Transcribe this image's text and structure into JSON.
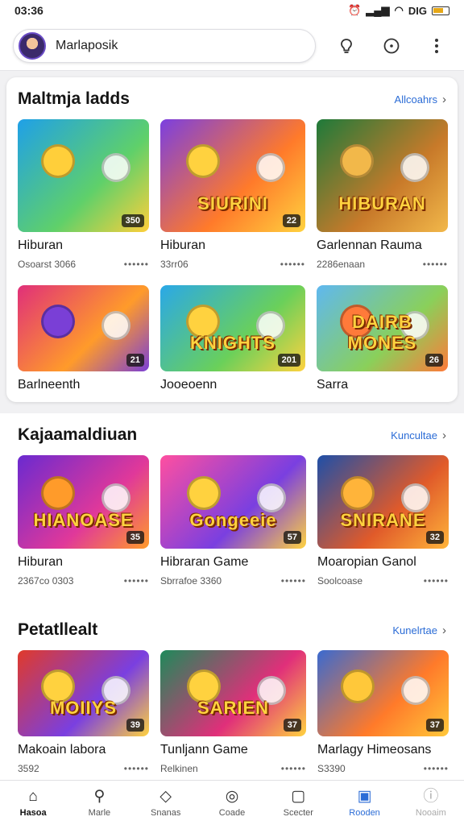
{
  "status_bar": {
    "time": "03:36",
    "icons": [
      "alarm-icon",
      "signal-icon",
      "wifi-icon",
      "battery-icon"
    ],
    "battery_text": "DIG"
  },
  "top_bar": {
    "search_text": "Marlaposik",
    "actions": [
      "lightbulb-icon",
      "compass-icon",
      "more-icon"
    ]
  },
  "sections": [
    {
      "title": "Maltmja ladds",
      "more": "Allcoahrs",
      "rows": [
        [
          {
            "name": "Hiburan",
            "meta": "Osoarst 3066",
            "badge": "350",
            "art_title": "",
            "colors": [
              "#1fa0e8",
              "#5fd06a",
              "#ffcf3a"
            ]
          },
          {
            "name": "Hiburan",
            "meta": "33rr06",
            "badge": "22",
            "art_title": "SIURINI",
            "colors": [
              "#7b3fe0",
              "#ff7a2a",
              "#ffd23f"
            ]
          },
          {
            "name": "Garlennan Rauma",
            "meta": "2286enaan",
            "badge": "",
            "art_title": "HIBURAN",
            "colors": [
              "#1e7a3a",
              "#c87a2a",
              "#f2b84a"
            ]
          }
        ],
        [
          {
            "name": "Barlneenth",
            "meta": "",
            "badge": "21",
            "art_title": "",
            "colors": [
              "#e02f7a",
              "#ff9b2a",
              "#7a3fd6"
            ]
          },
          {
            "name": "Jooeoenn",
            "meta": "",
            "badge": "201",
            "art_title": "KNIGHTS",
            "colors": [
              "#2aa8e8",
              "#6ad05a",
              "#ffd23f"
            ]
          },
          {
            "name": "Sarra",
            "meta": "",
            "badge": "26",
            "art_title": "DAIRB MONES",
            "colors": [
              "#5fb8f0",
              "#8ad05a",
              "#ff7a3a"
            ]
          }
        ]
      ]
    },
    {
      "title": "Kajaamaldiuan",
      "more": "Kuncultae",
      "rows": [
        [
          {
            "name": "Hiburan",
            "meta": "2367co 0303",
            "badge": "35",
            "art_title": "HIANOASE",
            "colors": [
              "#6a2ad0",
              "#e0389a",
              "#ff9b2a"
            ]
          },
          {
            "name": "Hibraran Game",
            "meta": "Sbrrafoe 3360",
            "badge": "57",
            "art_title": "Gongeeie",
            "colors": [
              "#ff4fa0",
              "#7a3fe0",
              "#ffd23f"
            ]
          },
          {
            "name": "Moaropian Ganol",
            "meta": "Soolcoase",
            "badge": "32",
            "art_title": "SNIRANE",
            "colors": [
              "#1e4fa8",
              "#e05a2a",
              "#ffb43a"
            ]
          }
        ]
      ]
    },
    {
      "title": "Petatllealt",
      "more": "Kunelrtae",
      "rows": [
        [
          {
            "name": "Makoain labora",
            "meta": "3592",
            "badge": "39",
            "art_title": "MOIIYS",
            "colors": [
              "#e03a2a",
              "#7a3fe0",
              "#ffd23f"
            ]
          },
          {
            "name": "Tunljann Game",
            "meta": "Relkinen",
            "badge": "37",
            "art_title": "SARIEN",
            "colors": [
              "#1e8a5a",
              "#e02f7a",
              "#ffd23f"
            ]
          },
          {
            "name": "Marlagy Himeosans",
            "meta": "S3390",
            "badge": "37",
            "art_title": "",
            "colors": [
              "#3a6ad0",
              "#ff7a2a",
              "#ffc83a"
            ]
          }
        ]
      ]
    }
  ],
  "bottom_nav": [
    {
      "label": "Hasoa",
      "icon": "home-icon",
      "glyph": "⌂",
      "state": "active"
    },
    {
      "label": "Marle",
      "icon": "search-icon",
      "glyph": "⚲",
      "state": ""
    },
    {
      "label": "Snanas",
      "icon": "tag-icon",
      "glyph": "◇",
      "state": ""
    },
    {
      "label": "Coade",
      "icon": "gamepad-icon",
      "glyph": "◎",
      "state": ""
    },
    {
      "label": "Scecter",
      "icon": "bag-icon",
      "glyph": "▢",
      "state": ""
    },
    {
      "label": "Rooden",
      "icon": "library-icon",
      "glyph": "▣",
      "state": "highlight"
    },
    {
      "label": "Nooaim",
      "icon": "info-icon",
      "glyph": "ⓘ",
      "state": "faded"
    }
  ]
}
